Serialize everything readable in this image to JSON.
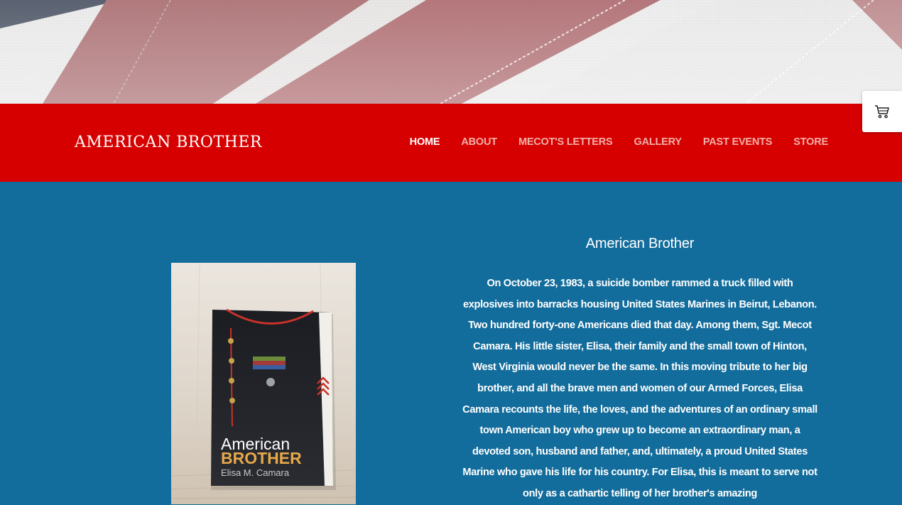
{
  "site": {
    "logo": "AMERICAN BROTHER"
  },
  "nav": {
    "items": [
      {
        "label": "HOME",
        "active": true
      },
      {
        "label": "ABOUT",
        "active": false
      },
      {
        "label": "MECOT'S LETTERS",
        "active": false
      },
      {
        "label": "GALLERY",
        "active": false
      },
      {
        "label": "PAST EVENTS",
        "active": false
      },
      {
        "label": "STORE",
        "active": false
      }
    ]
  },
  "cart": {
    "icon": "shopping-cart-icon"
  },
  "book": {
    "title_line1": "American",
    "title_line2": "BROTHER",
    "author": "Elisa M. Camara"
  },
  "main": {
    "heading": "American Brother",
    "body": "On October 23, 1983, a suicide bomber rammed a truck filled with explosives into barracks housing United States Marines in Beirut, Lebanon. Two hundred forty-one Americans died that day. Among them, Sgt. Mecot Camara. His little sister, Elisa, their family and the small town of Hinton, West Virginia would never be the same. In this moving tribute to her big brother, and all the brave men and women of our Armed Forces, Elisa Camara recounts the life, the loves, and the adventures of an ordinary small town American boy who grew up to become an extraordinary man, a devoted son, husband and father, and, ultimately, a proud United States Marine who gave his life for his country. For Elisa, this is meant to serve not only as a cathartic telling of her brother's amazing"
  },
  "colors": {
    "navbar": "#d60000",
    "page_bg": "#136d9c",
    "nav_inactive": "#f3b0a8",
    "nav_active": "#ffffff"
  }
}
